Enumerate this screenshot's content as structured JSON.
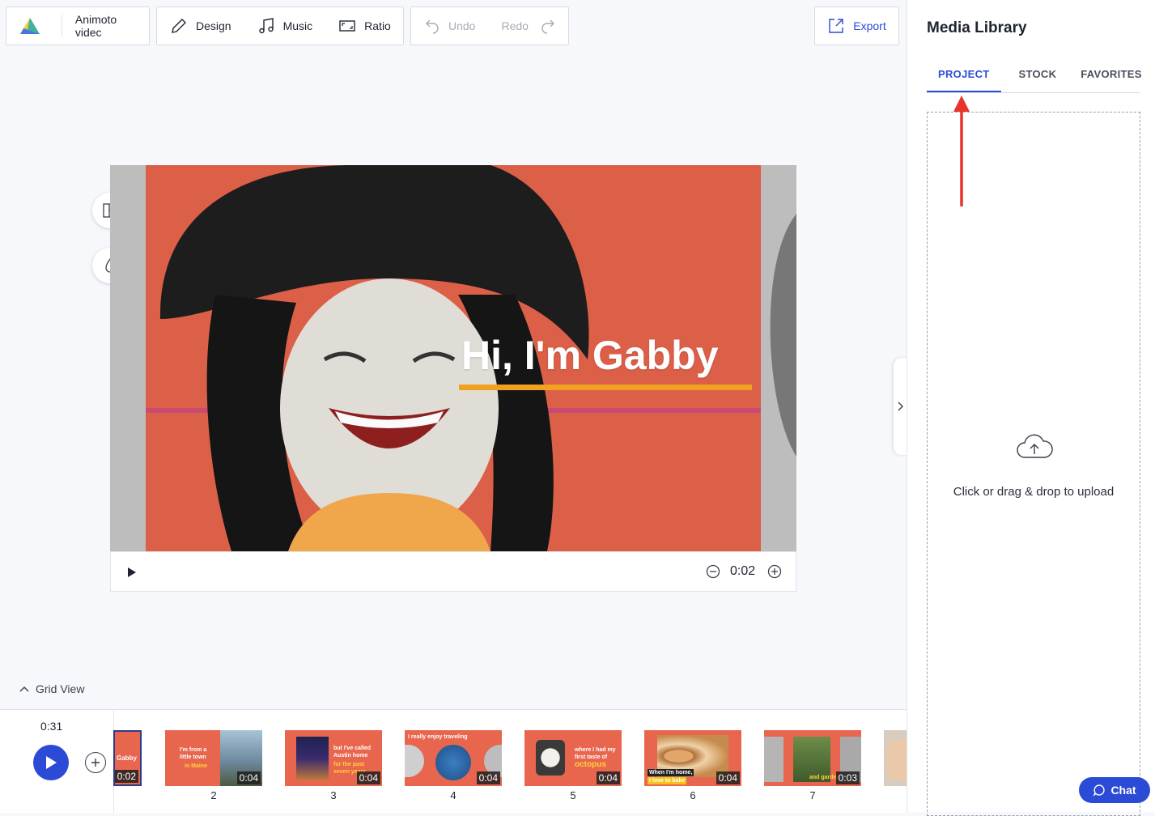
{
  "toolbar": {
    "project_name": "Animoto videc",
    "design": "Design",
    "music": "Music",
    "ratio": "Ratio",
    "undo": "Undo",
    "redo": "Redo",
    "export": "Export"
  },
  "preview": {
    "title": "Hi, I'm Gabby",
    "current_time": "0:02"
  },
  "panel": {
    "title": "Media Library",
    "tabs": [
      "PROJECT",
      "STOCK",
      "FAVORITES"
    ],
    "active_tab": "PROJECT",
    "upload_text": "Click or drag & drop to upload",
    "chat": "Chat"
  },
  "timeline": {
    "grid_view": "Grid View",
    "total_time": "0:31",
    "scenes": [
      {
        "num": "",
        "duration": "0:02",
        "caption": "Gabby",
        "caption2": ""
      },
      {
        "num": "2",
        "duration": "0:04",
        "caption": "I'm from a little town",
        "caption2": "in Maine"
      },
      {
        "num": "3",
        "duration": "0:04",
        "caption": "but I've called Austin home",
        "caption2": "for the past seven years"
      },
      {
        "num": "4",
        "duration": "0:04",
        "caption": "I really enjoy traveling",
        "caption2": ""
      },
      {
        "num": "5",
        "duration": "0:04",
        "caption": "where I had my first taste of",
        "caption2": "octopus"
      },
      {
        "num": "6",
        "duration": "0:04",
        "caption": "When I'm home,",
        "caption2": "I love to bake"
      },
      {
        "num": "7",
        "duration": "0:03",
        "caption": "",
        "caption2": "and garden"
      }
    ]
  },
  "colors": {
    "accent": "#2b4bd6",
    "scene_bg": "#e8664e",
    "underline": "#f2a01f",
    "annotation_arrow": "#e8342b"
  }
}
